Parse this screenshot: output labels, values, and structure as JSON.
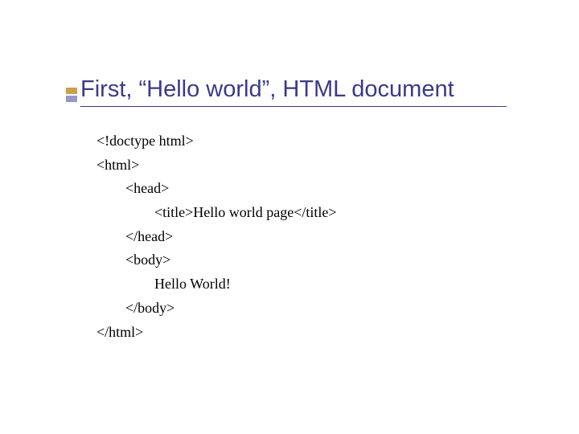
{
  "slide": {
    "title": "First, “Hello world”, HTML document"
  },
  "code": {
    "line1": "<!doctype html>",
    "line2": "<html>",
    "line3": "<head>",
    "line4": "<title>Hello world page</title>",
    "line5": "</head>",
    "line6": "<body>",
    "line7": "Hello World!",
    "line8": "</body>",
    "line9": "</html>"
  }
}
